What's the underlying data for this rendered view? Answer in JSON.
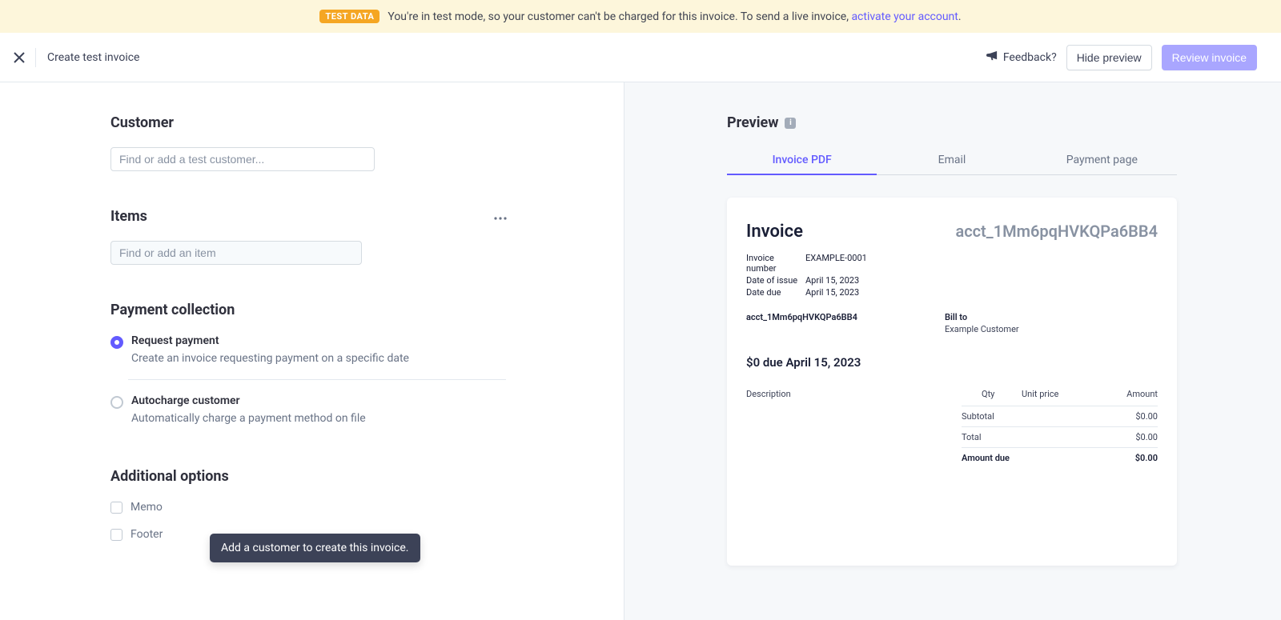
{
  "banner": {
    "badge": "TEST DATA",
    "text_prefix": "You're in test mode, so your customer can't be charged for this invoice. To send a live invoice, ",
    "link": "activate your account",
    "text_suffix": "."
  },
  "header": {
    "title": "Create test invoice",
    "feedback": "Feedback?",
    "hide_preview": "Hide preview",
    "review_invoice": "Review invoice"
  },
  "left": {
    "customer": {
      "title": "Customer",
      "placeholder": "Find or add a test customer..."
    },
    "items": {
      "title": "Items",
      "placeholder": "Find or add an item"
    },
    "payment": {
      "title": "Payment collection",
      "opt1_label": "Request payment",
      "opt1_desc": "Create an invoice requesting payment on a specific date",
      "opt2_label": "Autocharge customer",
      "opt2_desc": "Automatically charge a payment method on file"
    },
    "additional": {
      "title": "Additional options",
      "memo": "Memo",
      "footer": "Footer"
    },
    "tooltip": "Add a customer to create this invoice."
  },
  "preview": {
    "title": "Preview",
    "tabs": {
      "pdf": "Invoice PDF",
      "email": "Email",
      "payment": "Payment page"
    },
    "invoice": {
      "heading": "Invoice",
      "account": "acct_1Mm6pqHVKQPa6BB4",
      "meta": {
        "number_label": "Invoice number",
        "number": "EXAMPLE-0001",
        "issue_label": "Date of issue",
        "issue": "April 15, 2023",
        "due_label": "Date due",
        "due": "April 15, 2023"
      },
      "from": "acct_1Mm6pqHVKQPa6BB4",
      "bill_to_label": "Bill to",
      "bill_to_name": "Example Customer",
      "due_line": "$0 due April 15, 2023",
      "columns": {
        "desc": "Description",
        "qty": "Qty",
        "unit": "Unit price",
        "amount": "Amount"
      },
      "totals": {
        "subtotal_label": "Subtotal",
        "subtotal": "$0.00",
        "total_label": "Total",
        "total": "$0.00",
        "due_label": "Amount due",
        "due": "$0.00"
      }
    }
  }
}
